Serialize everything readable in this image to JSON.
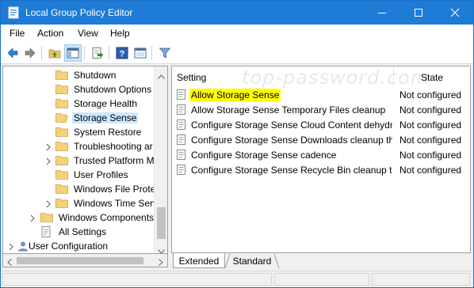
{
  "window": {
    "title": "Local Group Policy Editor",
    "accent": "#1e7bd6",
    "controls": [
      "minimize-icon",
      "maximize-icon",
      "close-icon"
    ]
  },
  "menu": [
    "File",
    "Action",
    "View",
    "Help"
  ],
  "toolbar": {
    "buttons": [
      "back-icon",
      "forward-icon",
      "up-folder-icon",
      "show-hide-tree-icon",
      "export-list-icon",
      "help-icon",
      "properties-icon",
      "filter-icon"
    ]
  },
  "tree": {
    "items": [
      {
        "label": "Shutdown",
        "expandable": false,
        "level": 2
      },
      {
        "label": "Shutdown Options",
        "expandable": false,
        "level": 2
      },
      {
        "label": "Storage Health",
        "expandable": false,
        "level": 2
      },
      {
        "label": "Storage Sense",
        "expandable": false,
        "level": 2,
        "selected": true
      },
      {
        "label": "System Restore",
        "expandable": false,
        "level": 2
      },
      {
        "label": "Troubleshooting ar",
        "expandable": true,
        "level": 2
      },
      {
        "label": "Trusted Platform M",
        "expandable": true,
        "level": 2
      },
      {
        "label": "User Profiles",
        "expandable": false,
        "level": 2
      },
      {
        "label": "Windows File Prote",
        "expandable": false,
        "level": 2
      },
      {
        "label": "Windows Time Serv",
        "expandable": true,
        "level": 2
      },
      {
        "label": "Windows Components",
        "expandable": true,
        "level": 1
      },
      {
        "label": "All Settings",
        "expandable": false,
        "level": 1
      },
      {
        "label": "User Configuration",
        "expandable": true,
        "level": 0
      }
    ]
  },
  "list": {
    "watermark": "top-password.com",
    "columns": {
      "setting": "Setting",
      "state": "State"
    },
    "rows": [
      {
        "name": "Allow Storage Sense",
        "state": "Not configured",
        "highlight": true
      },
      {
        "name": "Allow Storage Sense Temporary Files cleanup",
        "state": "Not configured"
      },
      {
        "name": "Configure Storage Sense Cloud Content dehydration threshold",
        "state": "Not configured"
      },
      {
        "name": "Configure Storage Sense Downloads cleanup threshold",
        "state": "Not configured"
      },
      {
        "name": "Configure Storage Sense cadence",
        "state": "Not configured"
      },
      {
        "name": "Configure Storage Sense Recycle Bin cleanup threshold",
        "state": "Not configured"
      }
    ],
    "highlight_color": "#ffff00"
  },
  "tabs": {
    "extended": "Extended",
    "standard": "Standard",
    "active": "Extended"
  }
}
